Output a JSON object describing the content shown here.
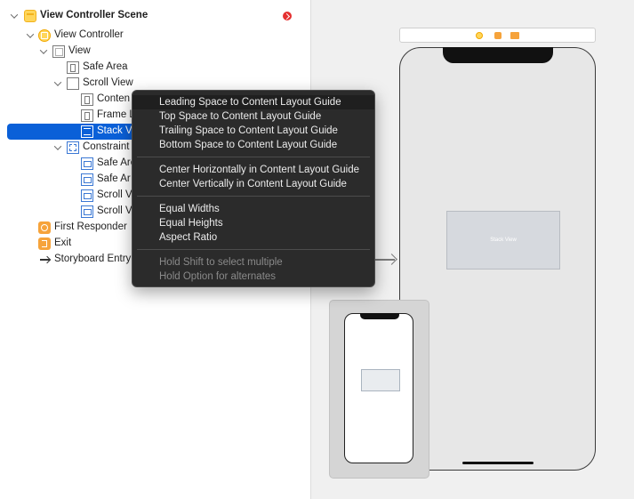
{
  "outline": {
    "items": [
      {
        "label": "View Controller Scene",
        "icon": "scene-icon"
      },
      {
        "label": "View Controller",
        "icon": "view-controller-icon"
      },
      {
        "label": "View",
        "icon": "view-icon"
      },
      {
        "label": "Safe Area",
        "icon": "layout-guide-icon"
      },
      {
        "label": "Scroll View",
        "icon": "scroll-view-icon"
      },
      {
        "label": "Conten",
        "icon": "layout-guide-icon"
      },
      {
        "label": "Frame L",
        "icon": "layout-guide-icon"
      },
      {
        "label": "Stack V",
        "icon": "stack-view-icon"
      },
      {
        "label": "Constraint",
        "icon": "constraints-icon"
      },
      {
        "label": "Safe Are",
        "icon": "constraint-icon"
      },
      {
        "label": "Safe Ar",
        "icon": "constraint-icon"
      },
      {
        "label": "Scroll V",
        "icon": "constraint-icon"
      },
      {
        "label": "Scroll V",
        "icon": "constraint-icon"
      },
      {
        "label": "First Responder",
        "icon": "first-responder-icon"
      },
      {
        "label": "Exit",
        "icon": "exit-icon"
      },
      {
        "label": "Storyboard Entry P",
        "icon": "entry-point-arrow-icon"
      }
    ]
  },
  "canvas": {
    "stack_label": "Stack View"
  },
  "context_menu": {
    "items": [
      "Leading Space to Content Layout Guide",
      "Top Space to Content Layout Guide",
      "Trailing Space to Content Layout Guide",
      "Bottom Space to Content Layout Guide",
      "Center Horizontally in Content Layout Guide",
      "Center Vertically in Content Layout Guide",
      "Equal Widths",
      "Equal Heights",
      "Aspect Ratio",
      "Hold Shift to select multiple",
      "Hold Option for alternates"
    ]
  },
  "colors": {
    "selection": "#0a60d8",
    "menu_bg": "#2b2b2b",
    "warning": "#e53030",
    "accent_yellow": "#ffd65b"
  }
}
